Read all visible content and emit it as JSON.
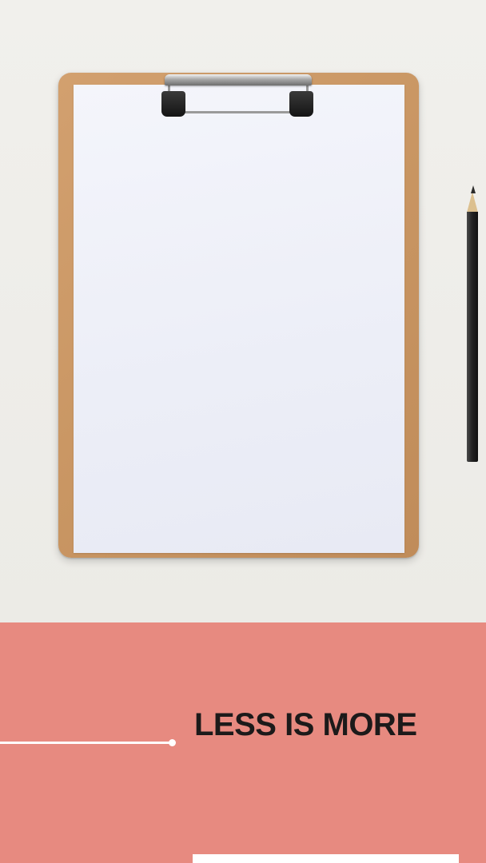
{
  "banner": {
    "headline": "LESS IS MORE",
    "background_color": "#e78a80",
    "text_color": "#1c1a1a",
    "accent_color": "#ffffff"
  },
  "photo": {
    "subject": "clipboard-with-blank-paper",
    "props": [
      "clipboard-icon",
      "pencil-icon"
    ]
  }
}
